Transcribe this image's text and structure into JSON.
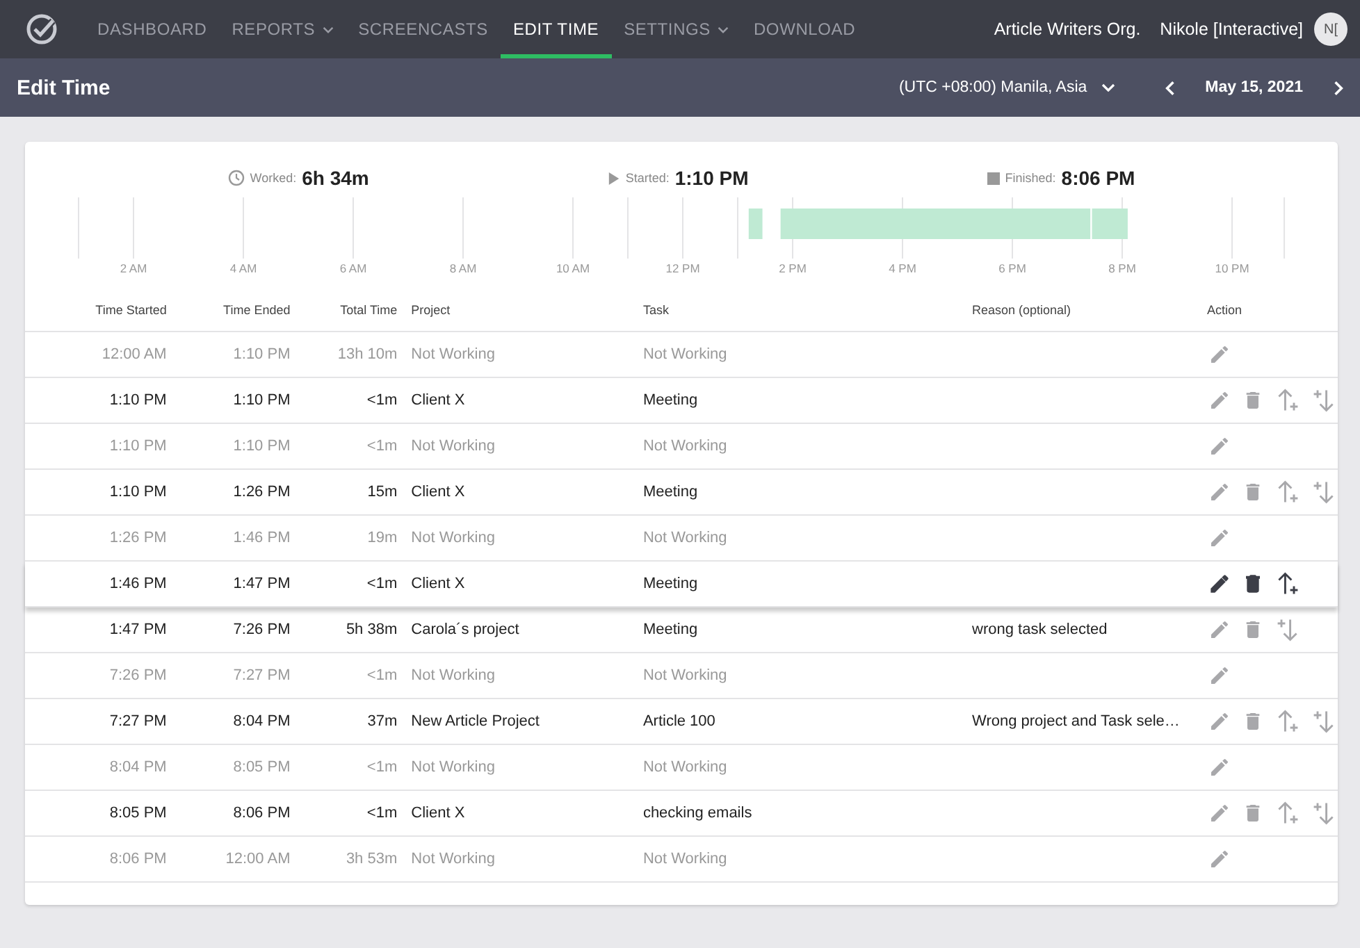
{
  "nav": {
    "items": [
      {
        "label": "DASHBOARD",
        "dropdown": false,
        "selected": false
      },
      {
        "label": "REPORTS",
        "dropdown": true,
        "selected": false
      },
      {
        "label": "SCREENCASTS",
        "dropdown": false,
        "selected": false
      },
      {
        "label": "EDIT TIME",
        "dropdown": false,
        "selected": true
      },
      {
        "label": "SETTINGS",
        "dropdown": true,
        "selected": false
      },
      {
        "label": "DOWNLOAD",
        "dropdown": false,
        "selected": false
      }
    ],
    "organization": "Article Writers Org.",
    "user": "Nikole [Interactive]",
    "avatar": "N["
  },
  "header": {
    "title": "Edit Time",
    "timezone": "(UTC +08:00) Manila, Asia",
    "date": "May 15, 2021"
  },
  "summary": [
    {
      "kind": "worked",
      "label": "Worked:",
      "value": "6h 34m"
    },
    {
      "kind": "started",
      "label": "Started:",
      "value": "1:10 PM"
    },
    {
      "kind": "finished",
      "label": "Finished:",
      "value": "8:06 PM"
    }
  ],
  "timeline_labels": [
    "2 AM",
    "4 AM",
    "6 AM",
    "8 AM",
    "10 AM",
    "12 PM",
    "2 PM",
    "4 PM",
    "6 PM",
    "8 PM",
    "10 PM"
  ],
  "table": {
    "columns": [
      "Time Started",
      "Time Ended",
      "Total Time",
      "Project",
      "Task",
      "Reason (optional)",
      "Action"
    ],
    "rows": [
      {
        "kind": "idle",
        "hovered": false,
        "start": "12:00 AM",
        "end": "1:10 PM",
        "total": "13h 10m",
        "project": "Not Working",
        "task": "Not Working",
        "reason": null
      },
      {
        "kind": "work",
        "hovered": false,
        "start": "1:10 PM",
        "end": "1:10 PM",
        "total": "<1m",
        "project": "Client X",
        "task": "Meeting",
        "reason": null,
        "insert_above": true,
        "insert_below": true
      },
      {
        "kind": "idle",
        "hovered": false,
        "start": "1:10 PM",
        "end": "1:10 PM",
        "total": "<1m",
        "project": "Not Working",
        "task": "Not Working",
        "reason": null
      },
      {
        "kind": "work",
        "hovered": false,
        "start": "1:10 PM",
        "end": "1:26 PM",
        "total": "15m",
        "project": "Client X",
        "task": "Meeting",
        "reason": null,
        "insert_above": true,
        "insert_below": true
      },
      {
        "kind": "idle",
        "hovered": false,
        "start": "1:26 PM",
        "end": "1:46 PM",
        "total": "19m",
        "project": "Not Working",
        "task": "Not Working",
        "reason": null
      },
      {
        "kind": "work",
        "hovered": true,
        "start": "1:46 PM",
        "end": "1:47 PM",
        "total": "<1m",
        "project": "Client X",
        "task": "Meeting",
        "reason": null,
        "insert_above": true,
        "insert_below": false
      },
      {
        "kind": "work",
        "hovered": false,
        "start": "1:47 PM",
        "end": "7:26 PM",
        "total": "5h 38m",
        "project": "Carola´s project",
        "task": "Meeting",
        "reason": "wrong task selected",
        "insert_above": false,
        "insert_below": true
      },
      {
        "kind": "idle",
        "hovered": false,
        "start": "7:26 PM",
        "end": "7:27 PM",
        "total": "<1m",
        "project": "Not Working",
        "task": "Not Working",
        "reason": null
      },
      {
        "kind": "work",
        "hovered": false,
        "start": "7:27 PM",
        "end": "8:04 PM",
        "total": "37m",
        "project": "New Article Project",
        "task": "Article 100",
        "reason": "Wrong project and Task sele…",
        "insert_above": true,
        "insert_below": true
      },
      {
        "kind": "idle",
        "hovered": false,
        "start": "8:04 PM",
        "end": "8:05 PM",
        "total": "<1m",
        "project": "Not Working",
        "task": "Not Working",
        "reason": null
      },
      {
        "kind": "work",
        "hovered": false,
        "start": "8:05 PM",
        "end": "8:06 PM",
        "total": "<1m",
        "project": "Client X",
        "task": "checking emails",
        "reason": null,
        "insert_above": true,
        "insert_below": true
      },
      {
        "kind": "idle",
        "hovered": false,
        "start": "8:06 PM",
        "end": "12:00 AM",
        "total": "3h 53m",
        "project": "Not Working",
        "task": "Not Working",
        "reason": null
      }
    ]
  }
}
